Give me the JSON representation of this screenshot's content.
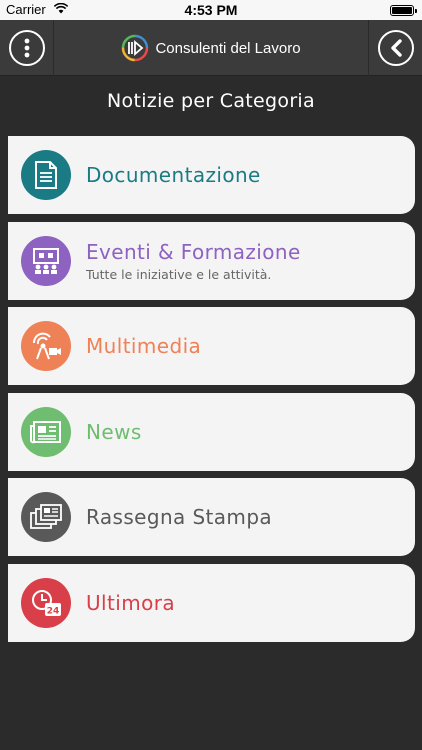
{
  "status_bar": {
    "carrier": "Carrier",
    "time": "4:53 PM"
  },
  "nav": {
    "title": "Consulenti del Lavoro",
    "menu_icon": "vertical-dots-icon",
    "back_icon": "chevron-left-icon"
  },
  "page": {
    "title": "Notizie per Categoria"
  },
  "categories": [
    {
      "label": "Documentazione",
      "subtitle": "",
      "color": "#1b7b85",
      "icon": "document-icon"
    },
    {
      "label": "Eventi & Formazione",
      "subtitle": "Tutte le iniziative e le attività.",
      "color": "#8e62c0",
      "icon": "presentation-icon"
    },
    {
      "label": "Multimedia",
      "subtitle": "",
      "color": "#ef8157",
      "icon": "broadcast-camera-icon"
    },
    {
      "label": "News",
      "subtitle": "",
      "color": "#6ebd71",
      "icon": "newspaper-icon"
    },
    {
      "label": "Rassegna Stampa",
      "subtitle": "",
      "color": "#595959",
      "icon": "press-review-icon"
    },
    {
      "label": "Ultimora",
      "subtitle": "",
      "color": "#d83f48",
      "icon": "clock-24-icon"
    }
  ]
}
